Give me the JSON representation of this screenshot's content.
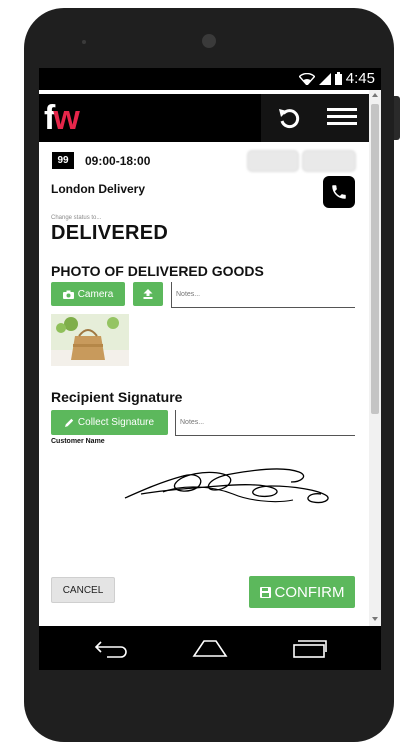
{
  "status_bar": {
    "time": "4:45",
    "icons": [
      "wifi-icon",
      "signal-icon",
      "battery-icon"
    ]
  },
  "app": {
    "logo_f": "f",
    "logo_w": "w",
    "brand_color": "#e6264a",
    "actions": [
      "refresh-icon",
      "hamburger-menu-icon"
    ]
  },
  "job": {
    "number": "99",
    "time_window": "09:00-18:00",
    "date_field": "",
    "ref_field": "",
    "title": "London Delivery"
  },
  "status": {
    "caption": "Change status to...",
    "value": "DELIVERED"
  },
  "photo_section": {
    "title": "PHOTO OF DELIVERED GOODS",
    "camera_label": "Camera",
    "notes_placeholder": "Notes..."
  },
  "signature_section": {
    "title": "Recipient Signature",
    "collect_label": "Collect Signature",
    "notes_placeholder": "Notes...",
    "customer_label": "Customer Name"
  },
  "footer": {
    "cancel_label": "CANCEL",
    "confirm_label": "CONFIRM",
    "accent": "#4cae4c"
  },
  "nav_bar": [
    "back-icon",
    "home-icon",
    "recent-apps-icon"
  ]
}
